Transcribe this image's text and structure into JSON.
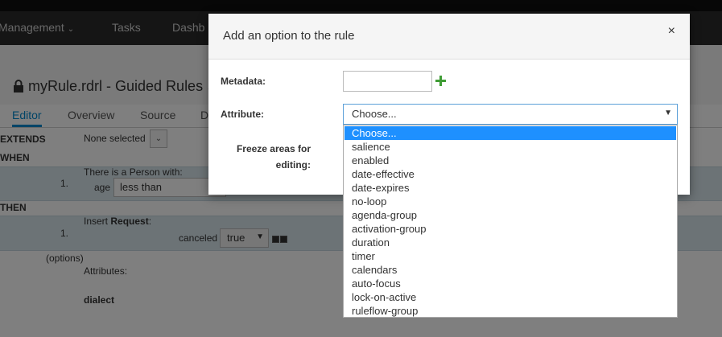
{
  "navbar": {
    "items": [
      {
        "label": "Management",
        "has_chevron": true
      },
      {
        "label": "Tasks"
      },
      {
        "label": "Dashb"
      }
    ]
  },
  "page": {
    "title": "myRule.rdrl - Guided Rules",
    "tabs": [
      "Editor",
      "Overview",
      "Source",
      "D"
    ],
    "active_tab": "Editor"
  },
  "rule": {
    "extends_label": "EXTENDS",
    "extends_value": "None selected",
    "when_label": "WHEN",
    "then_label": "THEN",
    "when_row_number": "1.",
    "when_pattern": "There is a Person with:",
    "when_field": "age",
    "when_operator": "less than",
    "then_row_number": "1.",
    "then_action_prefix": "Insert ",
    "then_action_fact": "Request",
    "then_action_suffix": ":",
    "then_field": "canceled",
    "then_value": "true",
    "options_label": "(options)",
    "attributes_label": "Attributes:",
    "dialect_label": "dialect"
  },
  "modal": {
    "title": "Add an option to the rule",
    "close_symbol": "×",
    "metadata_label": "Metadata:",
    "metadata_value": "",
    "attribute_label": "Attribute:",
    "attribute_selected": "Choose...",
    "freeze_label_line1": "Freeze areas for",
    "freeze_label_line2": "editing:"
  },
  "attribute_options": [
    "Choose...",
    "salience",
    "enabled",
    "date-effective",
    "date-expires",
    "no-loop",
    "agenda-group",
    "activation-group",
    "duration",
    "timer",
    "calendars",
    "auto-focus",
    "lock-on-active",
    "ruleflow-group"
  ],
  "colors": {
    "accent": "#0088ce",
    "selected_option": "#1e90ff",
    "row_band": "#d8e6ed",
    "add_icon": "#3f9c35"
  }
}
